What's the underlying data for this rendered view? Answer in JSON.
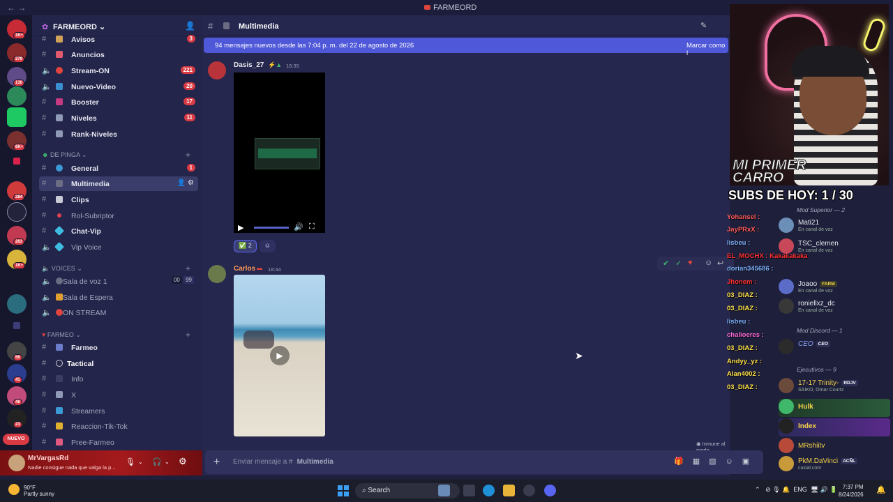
{
  "titlebar": {
    "title": "FARMEORD",
    "nav": "←  →"
  },
  "server_badges": [
    "1K+",
    "279",
    "130",
    "6K+",
    "284",
    "263",
    "1K+",
    "56",
    "41",
    "48",
    "23"
  ],
  "server_new": "NUEVO",
  "server_name": "FARMEORD",
  "channels_top": [
    {
      "name": "Avisos",
      "count": "3"
    },
    {
      "name": "Anuncios",
      "count": ""
    },
    {
      "name": "Stream-ON",
      "count": "221"
    },
    {
      "name": "Nuevo-Video",
      "count": "20"
    },
    {
      "name": "Booster",
      "count": "17"
    },
    {
      "name": "Niveles",
      "count": "11"
    },
    {
      "name": "Rank-Niveles",
      "count": ""
    }
  ],
  "category_de_pinga": "DE PINGA",
  "channels_pinga": [
    {
      "name": "General",
      "count": "1"
    },
    {
      "name": "Multimedia",
      "count": ""
    },
    {
      "name": "Clips",
      "count": ""
    },
    {
      "name": "Rol-Subriptor",
      "count": ""
    },
    {
      "name": "Chat-Vip",
      "count": ""
    },
    {
      "name": "Vip Voice",
      "count": ""
    }
  ],
  "category_voices": "VOICES",
  "voice_channels": [
    {
      "name": "Sala de voz 1",
      "meta_a": "00",
      "meta_b": "99"
    },
    {
      "name": "Sala de Espera"
    },
    {
      "name": "ON STREAM"
    }
  ],
  "category_farmeo": "FARMEO",
  "channels_farmeo": [
    {
      "name": "Farmeo"
    },
    {
      "name": "Tactical"
    },
    {
      "name": "Info"
    },
    {
      "name": "X"
    },
    {
      "name": "Streamers"
    },
    {
      "name": "Reaccion-Tik-Tok"
    },
    {
      "name": "Pree-Farmeo"
    }
  ],
  "user": {
    "name": "MrVargasRd",
    "status": "Nadie consigue nada que valga la p..."
  },
  "main": {
    "channel": "Multimedia",
    "new_messages": "94 mensajes nuevos desde las 7:04 p. m. del 22 de agosto de 2026",
    "mark_read": "Marcar como l",
    "msg1": {
      "author": "Dasis_27",
      "time": "18:35"
    },
    "reaction_count": "2",
    "msg2": {
      "author": "Carlos",
      "time": "18:44"
    },
    "immune": "Inmune al modo pausado",
    "composer_placeholder": "Enviar mensaje a #",
    "composer_channel": "Multimedia"
  },
  "overlay": {
    "logo_line1": "MI PRIMER",
    "logo_line2": "CARRO",
    "subs": "SUBS DE HOY: 1 / 30"
  },
  "chat_lines": [
    {
      "text": "Yohansel :",
      "color": "#ff5c5c"
    },
    {
      "text": "JayPRxX :",
      "color": "#ff5c5c"
    },
    {
      "text": "lisbeu :",
      "color": "#7fb3ff"
    },
    {
      "text": "EL_MOCHX : Kakakakaka",
      "color": "#ff3030"
    },
    {
      "text": "dorian345686 :",
      "color": "#7fb3ff"
    },
    {
      "text": "Jhonem :",
      "color": "#ff3030"
    },
    {
      "text": "03_DIAZ :",
      "color": "#ffe14a"
    },
    {
      "text": "03_DIAZ :",
      "color": "#ffe14a"
    },
    {
      "text": "lisbeu :",
      "color": "#7fb3ff"
    },
    {
      "text": "chalioeres :",
      "color": "#ff6fe0"
    },
    {
      "text": "03_DIAZ :",
      "color": "#ffe14a"
    },
    {
      "text": "Andyy_yz :",
      "color": "#ffe14a"
    },
    {
      "text": "Alan4002 :",
      "color": "#ffe14a"
    },
    {
      "text": "03_DIAZ :",
      "color": "#ffe14a"
    }
  ],
  "members": {
    "mod_superior": "Mod Superior — 2",
    "mod_discord": "Mod Discord — 1",
    "ejecutivos": "Ejecutivos — 9",
    "list": [
      {
        "name": "Mati21",
        "sub": "En canal de voz",
        "tag": ""
      },
      {
        "name": "TSC_clemen",
        "sub": "En canal de voz",
        "tag": ""
      },
      {
        "name": "Joaoo",
        "sub": "En canal de voz",
        "tag": "FARM"
      },
      {
        "name": "roniellxz_dc",
        "sub": "En canal de voz",
        "tag": ""
      },
      {
        "name": "CEO",
        "sub": "",
        "tag": "CEO"
      },
      {
        "name": "17-17 Trinity-",
        "sub": "SAIKO, Omar Courtz",
        "tag": "RDJV"
      },
      {
        "name": "Hulk",
        "sub": "",
        "tag": ""
      },
      {
        "name": "Index",
        "sub": "",
        "tag": ""
      },
      {
        "name": "MRshiitv",
        "sub": "",
        "tag": ""
      },
      {
        "name": "PkM.DaVinci",
        "sub": "cuxial.com",
        "tag": "ACÑL"
      }
    ]
  },
  "taskbar": {
    "temp": "90°F",
    "weather": "Partly sunny",
    "search": "Search",
    "lang": "ENG",
    "time": "7:37 PM",
    "date": "8/24/2026"
  }
}
